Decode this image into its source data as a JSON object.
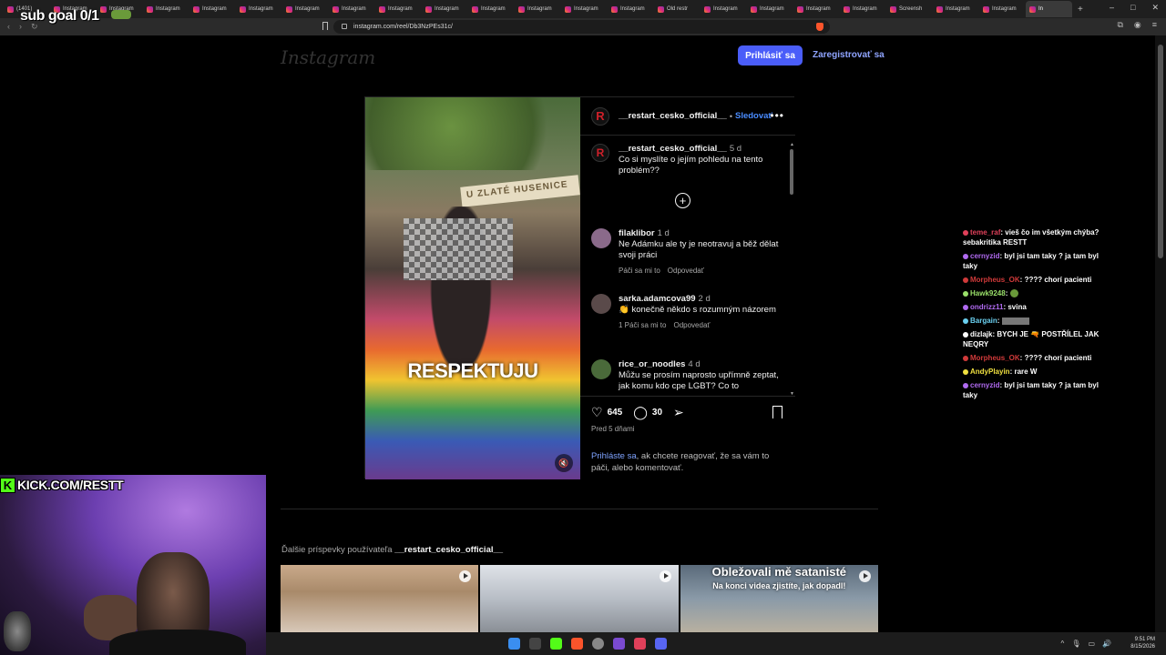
{
  "browser": {
    "tabs": [
      {
        "label": "(1401) ",
        "active": false
      },
      {
        "label": "Instagram",
        "active": false
      },
      {
        "label": "Instagram",
        "active": false
      },
      {
        "label": "Instagram",
        "active": false
      },
      {
        "label": "Instagram",
        "active": false
      },
      {
        "label": "Instagram",
        "active": false
      },
      {
        "label": "Instagram",
        "active": false
      },
      {
        "label": "Instagram",
        "active": false
      },
      {
        "label": "Instagram",
        "active": false
      },
      {
        "label": "Instagram",
        "active": false
      },
      {
        "label": "Instagram",
        "active": false
      },
      {
        "label": "Instagram",
        "active": false
      },
      {
        "label": "Instagram",
        "active": false
      },
      {
        "label": "Instagram",
        "active": false
      },
      {
        "label": "Old restr",
        "active": false
      },
      {
        "label": "Instagram",
        "active": false
      },
      {
        "label": "Instagram",
        "active": false
      },
      {
        "label": "Instagram",
        "active": false
      },
      {
        "label": "Instagram",
        "active": false
      },
      {
        "label": "Screensh",
        "active": false
      },
      {
        "label": "Instagram",
        "active": false
      },
      {
        "label": "Instagram",
        "active": false
      },
      {
        "label": "In",
        "active": true
      }
    ],
    "url": "instagram.com/reel/Db3NzPEs31c/"
  },
  "overlay": {
    "sub_goal": "sub goal 0/1",
    "kick_label": "KICK.COM/RESTT"
  },
  "header": {
    "logo": "Instagram",
    "login_button": "Prihlásiť sa",
    "register_link": "Zaregistrovať sa"
  },
  "reel": {
    "video_caption": "RESPEKTUJU",
    "sign_text": "U ZLATÉ HUSENICE",
    "author": "__restart_cesko_official__",
    "author_initial": "R",
    "follow": "Sledovať",
    "caption_comment": {
      "user": "__restart_cesko_official__",
      "time": "5 d",
      "text": "Co si myslíte o jejím pohledu na tento problém??"
    },
    "comments": [
      {
        "user": "filaklibor",
        "time": "1 d",
        "text": "Ne Adámku ale ty je neotravuj a běž dělat svoji práci",
        "likes": "Páči sa mi to",
        "reply": "Odpovedať",
        "color": "#8a6a8a"
      },
      {
        "user": "sarka.adamcova99",
        "time": "2 d",
        "text": "👏 konečně někdo s rozumným názorem",
        "likes": "1 Páči sa mi to",
        "reply": "Odpovedať",
        "color": "#5a4a4a"
      },
      {
        "user": "rice_or_noodles",
        "time": "4 d",
        "text": "Můžu se prosím naprosto upřímně zeptat, jak komu kdo cpe LGBT? Co to",
        "likes": "",
        "reply": "",
        "color": "#4a6a3a"
      }
    ],
    "likes_count": "645",
    "comments_count": "30",
    "post_time": "Pred 5 dňami",
    "login_prompt_link": "Prihláste sa",
    "login_prompt_rest": ", ak chcete reagovať, že sa vám to páči, alebo komentovať."
  },
  "more_posts": {
    "prefix": "Ďalšie príspevky používateľa",
    "user": "__restart_cesko_official__",
    "thumbs": [
      {
        "line1": "",
        "line2": ""
      },
      {
        "line1": "",
        "line2": ""
      },
      {
        "line1": "Obležovali mě satanisté",
        "line2": "Na konci videa zjistíte, jak dopadl!"
      }
    ]
  },
  "chat": [
    {
      "user": "teme_raf",
      "text": "vieš čo im všetkým chýba? sebakritika RESTT",
      "color": "#e0405a"
    },
    {
      "user": "cernyzid",
      "text": "byl jsi tam taky ? ja tam byl taky",
      "color": "#b06af0"
    },
    {
      "user": "Morpheus_OK",
      "text": "???? chorí pacienti",
      "color": "#d03a3a"
    },
    {
      "user": "Hawk9248",
      "text": "",
      "color": "#9ae06a"
    },
    {
      "user": "ondrizz11",
      "text": "svina",
      "color": "#b06af0"
    },
    {
      "user": "Bargain",
      "text": "",
      "color": "#6ad0f0"
    },
    {
      "user": "dizlajk",
      "text": "BYCH JE 🔫 POSTŘÍLEL JAK NEQRY",
      "color": "#ffffff"
    },
    {
      "user": "Morpheus_OK",
      "text": "???? chorí pacienti",
      "color": "#d03a3a"
    },
    {
      "user": "AndyPlayin",
      "text": "rare W",
      "color": "#f0e040"
    },
    {
      "user": "cernyzid",
      "text": "byl jsi tam taky ? ja tam byl taky",
      "color": "#b06af0"
    }
  ],
  "taskbar": {
    "time": "9:51 PM",
    "date": "8/15/2026"
  }
}
